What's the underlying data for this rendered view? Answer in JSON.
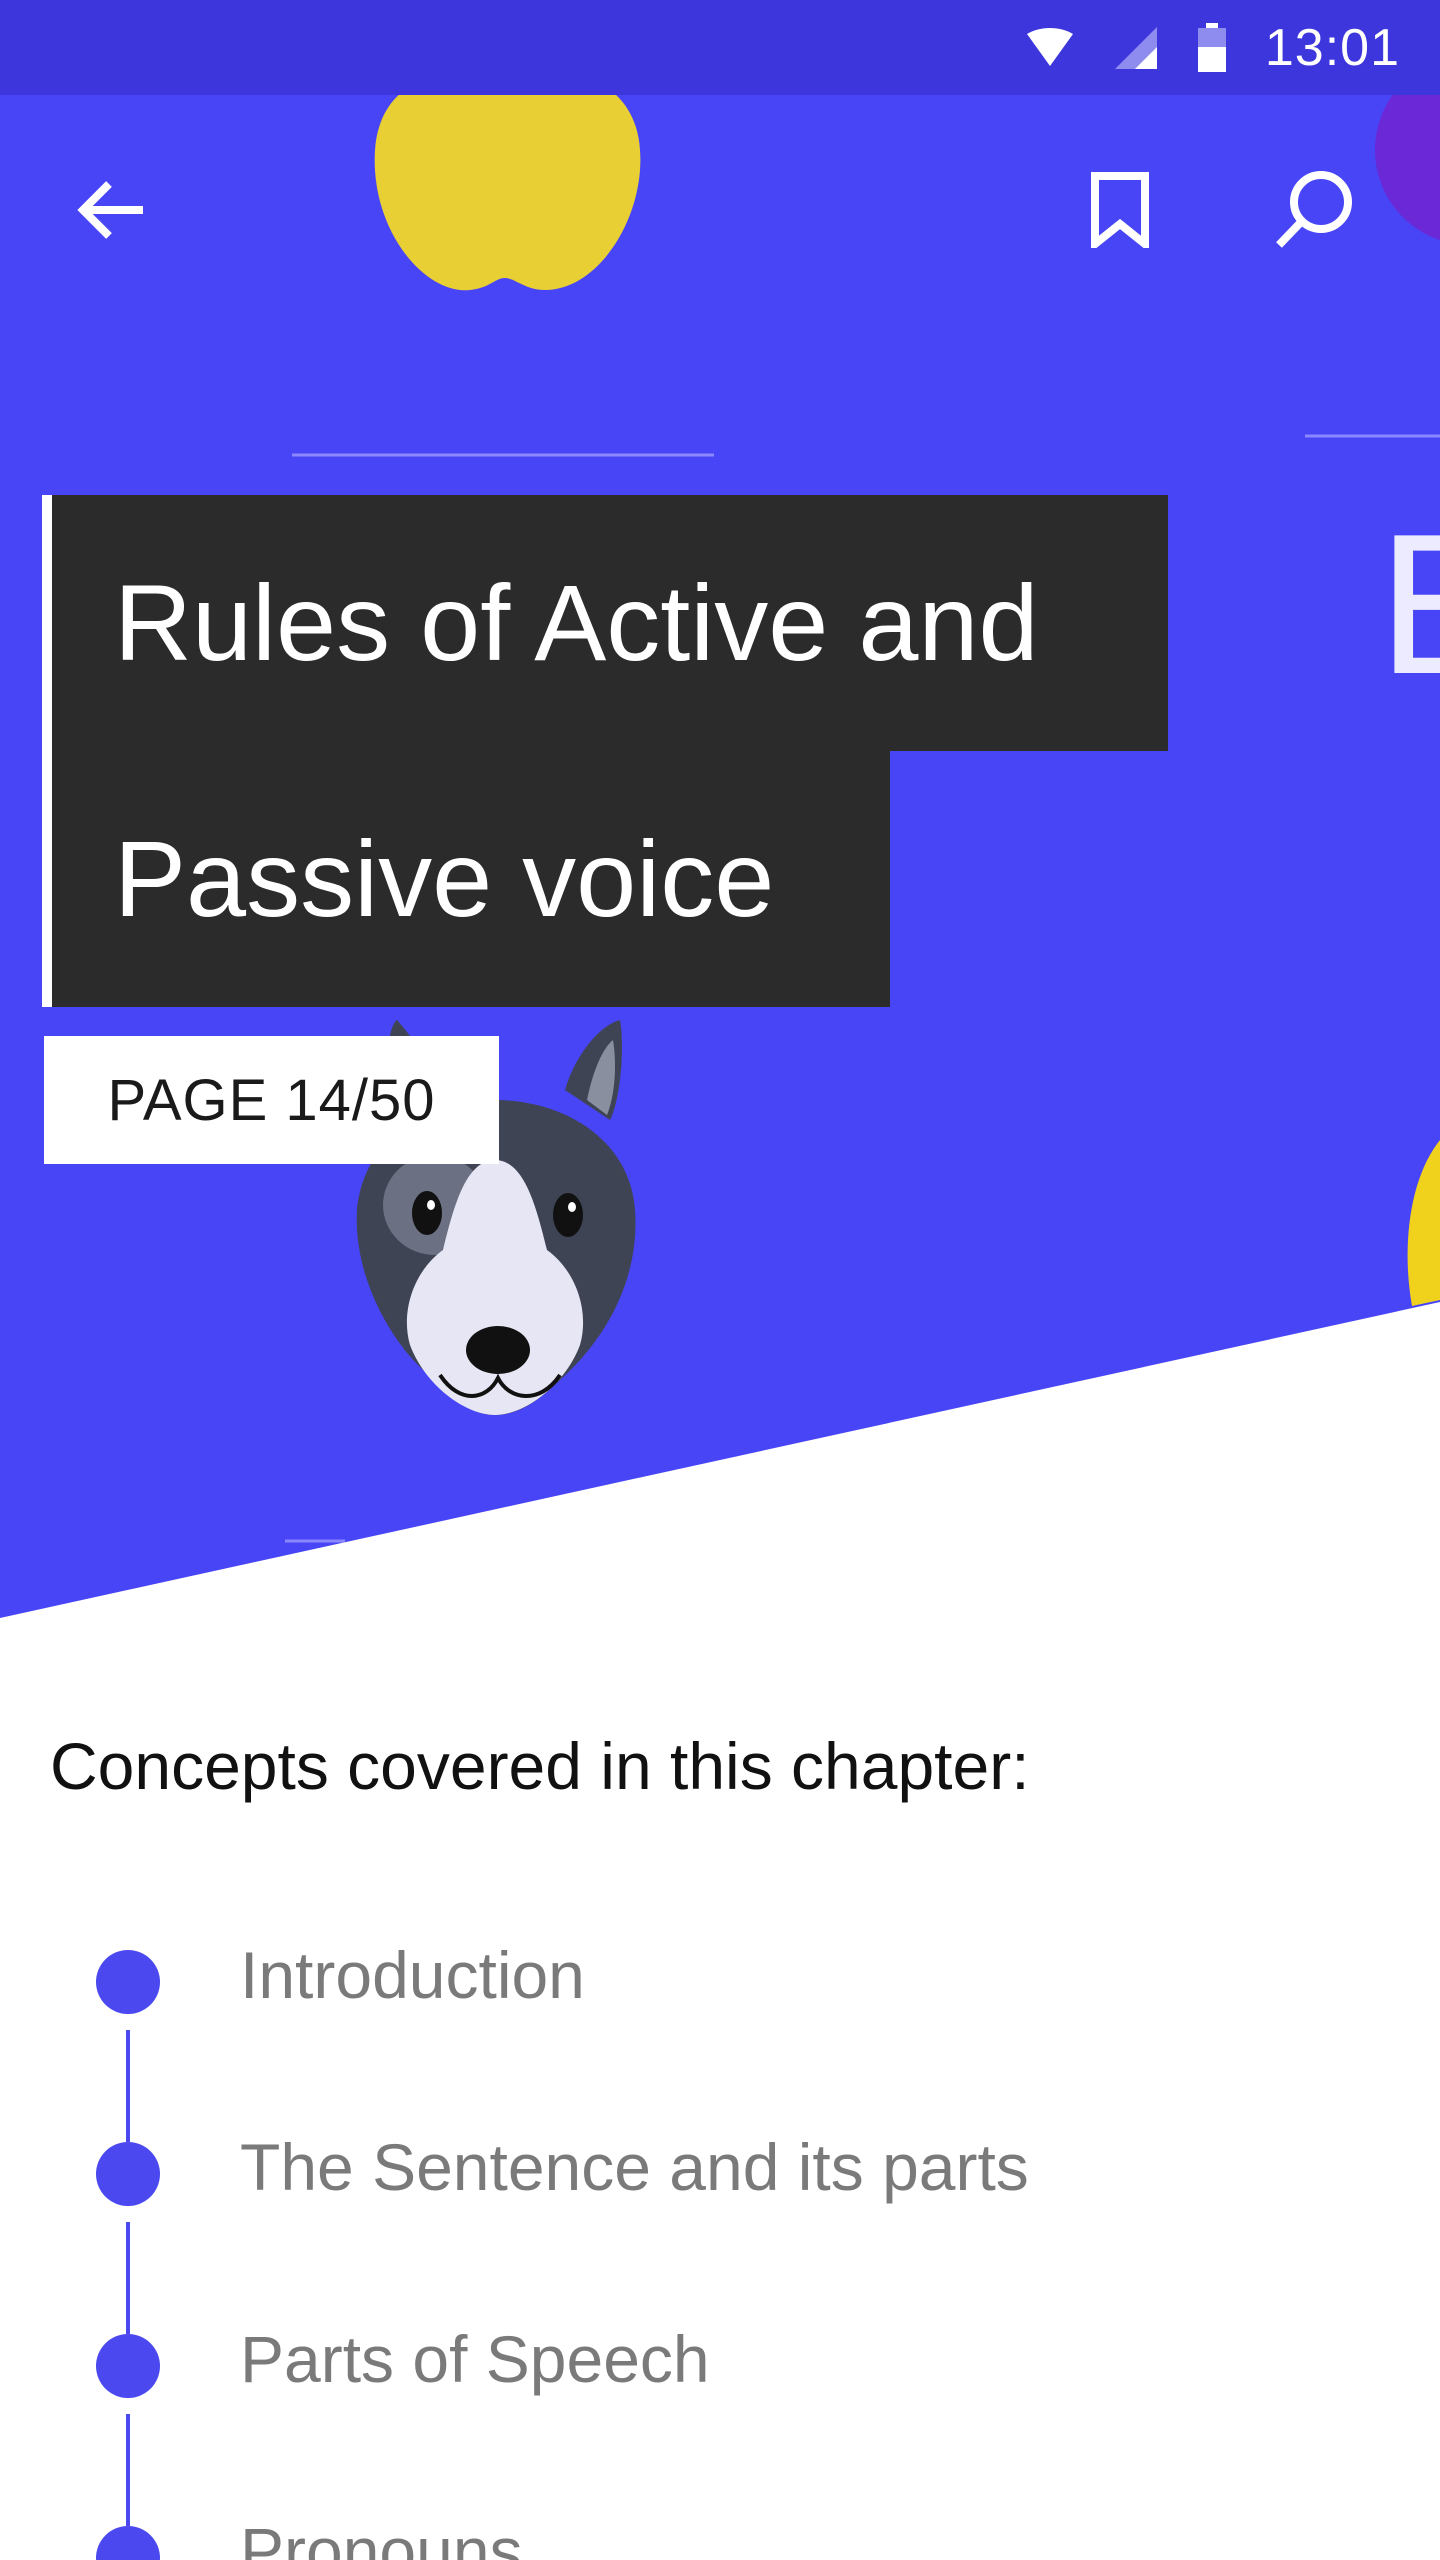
{
  "status_bar": {
    "time": "13:01",
    "icons": [
      "wifi-icon",
      "cell-signal-icon",
      "battery-icon"
    ]
  },
  "toolbar": {
    "back_icon": "back-arrow-icon",
    "bookmark_icon": "bookmark-icon",
    "search_icon": "search-icon"
  },
  "hero": {
    "title_line1": "Rules of Active and",
    "title_line2": "Passive voice",
    "page_label": "PAGE 14/50",
    "next_card_peek_letter": "E",
    "illustrations": [
      "apple-illustration",
      "dog-illustration"
    ]
  },
  "content": {
    "heading": "Concepts covered in this chapter:",
    "concepts": [
      "Introduction",
      "The Sentence and its parts",
      "Parts of Speech",
      "Pronouns"
    ]
  },
  "colors": {
    "hero_background": "#4845f6",
    "status_bar": "#3d36dd",
    "title_background": "#2b2b2b",
    "timeline_accent": "#4b48f0",
    "concept_text": "#7a7a7a"
  }
}
